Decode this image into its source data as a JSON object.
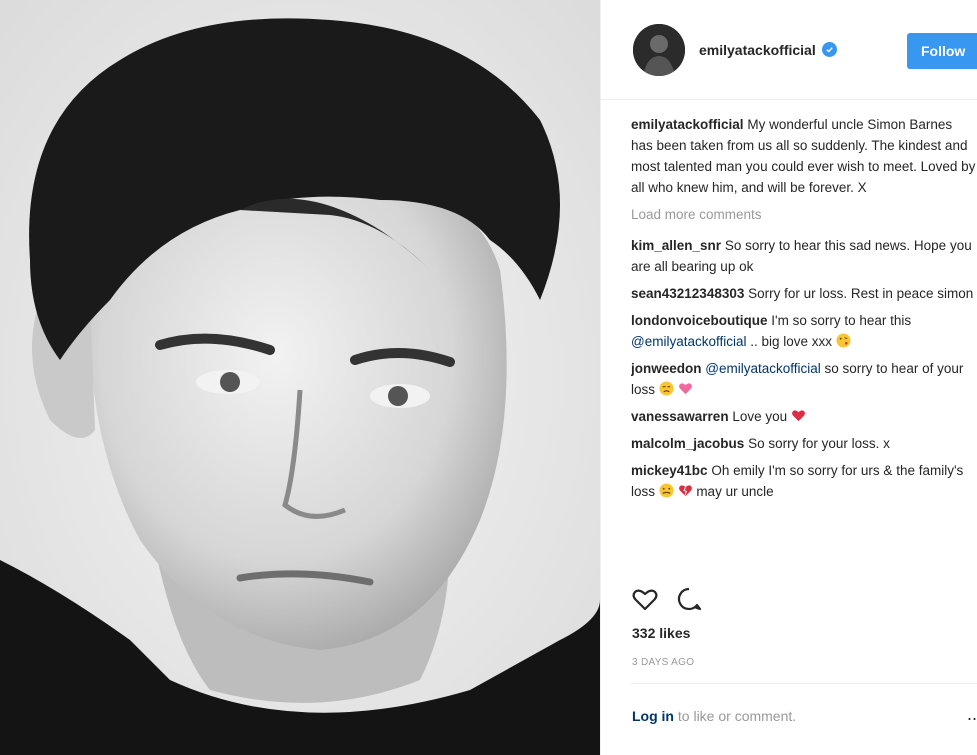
{
  "post": {
    "username": "emilyatackofficial",
    "follow_label": "Follow",
    "caption": "My wonderful uncle Simon Barnes has been taken from us all so suddenly. The kindest and most talented man you could ever wish to meet. Loved by all who knew him, and will be forever. X",
    "load_more": "Load more comments",
    "comments": [
      {
        "user": "kim_allen_snr",
        "text": "So sorry to hear this sad news. Hope you are all bearing up ok"
      },
      {
        "user": "sean43212348303",
        "text": "Sorry for ur loss. Rest in peace simon"
      },
      {
        "user": "londonvoiceboutique",
        "text": "I'm so sorry to hear this",
        "mention": "@emilyatackofficial",
        "text_after": ".. big love xxx"
      },
      {
        "user": "jonweedon",
        "mention": "@emilyatackofficial",
        "text_after": "so sorry to hear of your loss"
      },
      {
        "user": "vanessawarren",
        "text": "Love you"
      },
      {
        "user": "malcolm_jacobus",
        "text": "So sorry for your loss. x"
      },
      {
        "user": "mickey41bc",
        "text": "Oh emily I'm so sorry for urs & the family's loss",
        "text_after": "may ur uncle"
      }
    ],
    "likes": "332 likes",
    "time": "3 DAYS AGO",
    "login_link": "Log in",
    "login_text": "to like or comment.",
    "more": "..."
  },
  "icons": {
    "like": "heart-outline-icon",
    "comment": "comment-bubble-icon",
    "verified": "verified-badge-icon"
  },
  "colors": {
    "accent": "#3897f0",
    "link": "#003569",
    "muted": "#999999",
    "text": "#262626"
  }
}
